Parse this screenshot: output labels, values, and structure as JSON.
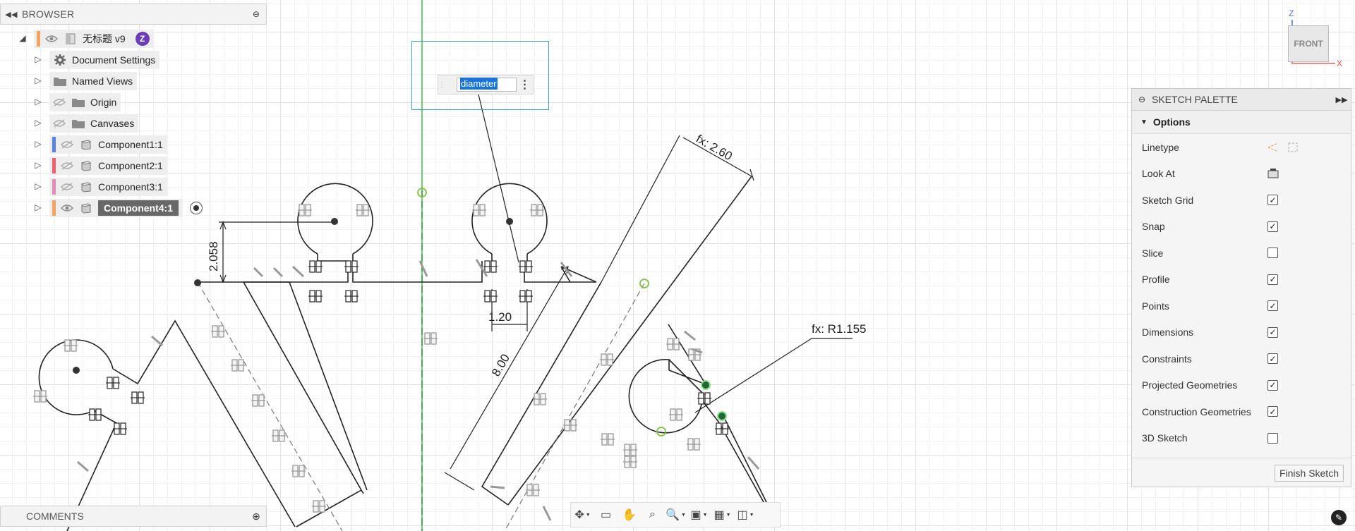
{
  "browser": {
    "title": "BROWSER",
    "root": {
      "label": "无标题 v9",
      "badge": "Z"
    },
    "items": [
      {
        "label": "Document Settings"
      },
      {
        "label": "Named Views"
      },
      {
        "label": "Origin"
      },
      {
        "label": "Canvases"
      },
      {
        "label": "Component1:1",
        "color": "#5b83e6"
      },
      {
        "label": "Component2:1",
        "color": "#f0616e"
      },
      {
        "label": "Component3:1",
        "color": "#e68ab8"
      },
      {
        "label": "Component4:1",
        "color": "#f4a360",
        "selected": true
      }
    ],
    "root_color": "#f4a360"
  },
  "comments": {
    "title": "COMMENTS"
  },
  "dimension_input": {
    "value": "diameter"
  },
  "sketch_dimensions": {
    "fx_length": "fx: 2.60",
    "fx_radius": "fx: R1.155",
    "d1": "2.058",
    "d2": "1.20",
    "d3": "8.00"
  },
  "viewcube": {
    "face": "FRONT",
    "z_axis": "Z",
    "x_axis": "X"
  },
  "sketch_palette": {
    "title": "SKETCH PALETTE",
    "section": "Options",
    "options": [
      {
        "label": "Linetype",
        "control": "icons"
      },
      {
        "label": "Look At",
        "control": "icon"
      },
      {
        "label": "Sketch Grid",
        "checked": true
      },
      {
        "label": "Snap",
        "checked": true
      },
      {
        "label": "Slice",
        "checked": false
      },
      {
        "label": "Profile",
        "checked": true
      },
      {
        "label": "Points",
        "checked": true
      },
      {
        "label": "Dimensions",
        "checked": true
      },
      {
        "label": "Constraints",
        "checked": true
      },
      {
        "label": "Projected Geometries",
        "checked": true
      },
      {
        "label": "Construction Geometries",
        "checked": true
      },
      {
        "label": "3D Sketch",
        "checked": false
      }
    ],
    "finish_label": "Finish Sketch"
  },
  "toolbar": {
    "buttons": [
      "orbit-icon",
      "look-at-icon",
      "pan-icon",
      "zoom-fit-icon",
      "zoom-window-icon",
      "display-settings-icon",
      "grid-snap-icon",
      "viewports-icon"
    ]
  },
  "colors": {
    "accent_blue": "#1a73d9",
    "green_axis": "#3fc43f",
    "selection_blue": "#3aa0d8"
  }
}
